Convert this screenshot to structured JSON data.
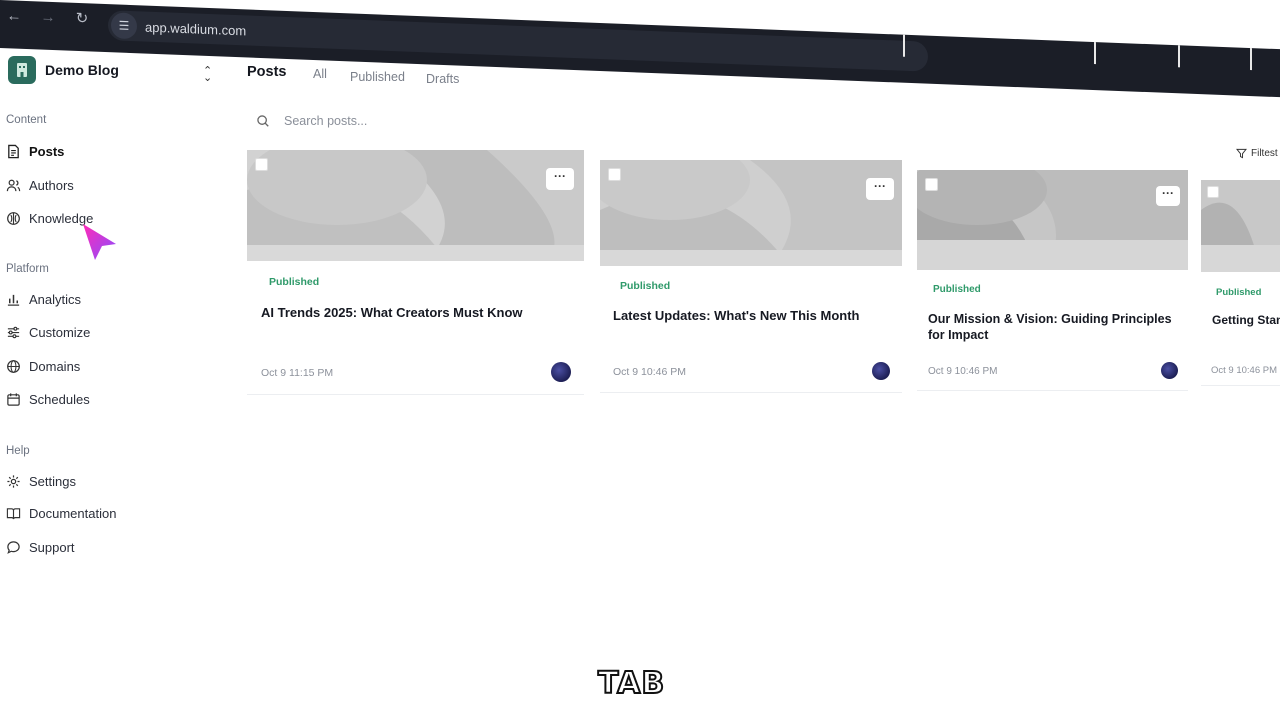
{
  "browser": {
    "url": "app.waldium.com",
    "back_icon": "arrow-left-icon",
    "forward_icon": "arrow-right-icon",
    "reload_icon": "reload-icon",
    "site_settings_icon": "tune-icon"
  },
  "brand": {
    "name": "Demo Blog",
    "logo_color": "#2a6b5d"
  },
  "sidebar": {
    "sections": [
      {
        "label": "Content",
        "items": [
          {
            "label": "Posts",
            "icon": "document-icon",
            "active": true
          },
          {
            "label": "Authors",
            "icon": "users-icon"
          },
          {
            "label": "Knowledge",
            "icon": "knowledge-icon"
          }
        ]
      },
      {
        "label": "Platform",
        "items": [
          {
            "label": "Analytics",
            "icon": "bar-chart-icon"
          },
          {
            "label": "Customize",
            "icon": "sliders-icon"
          },
          {
            "label": "Domains",
            "icon": "globe-icon"
          },
          {
            "label": "Schedules",
            "icon": "calendar-icon"
          }
        ]
      },
      {
        "label": "Help",
        "items": [
          {
            "label": "Settings",
            "icon": "gear-icon"
          },
          {
            "label": "Documentation",
            "icon": "book-icon"
          },
          {
            "label": "Support",
            "icon": "chat-icon"
          }
        ]
      }
    ]
  },
  "main": {
    "title": "Posts",
    "tabs": [
      "All",
      "Published",
      "Drafts"
    ],
    "search_placeholder": "Search posts...",
    "filter_label": "Filtest"
  },
  "posts": [
    {
      "status": "Published",
      "title": "AI Trends 2025: What Creators Must Know",
      "date": "Oct 9 11:15 PM"
    },
    {
      "status": "Published",
      "title": "Latest Updates: What's New This Month",
      "date": "Oct 9 10:46 PM"
    },
    {
      "status": "Published",
      "title": "Our Mission & Vision: Guiding Principles for Impact",
      "date": "Oct 9 10:46 PM"
    },
    {
      "status": "Published",
      "title": "Getting Stans",
      "date": "Oct 9 10:46 PM"
    }
  ],
  "more_label": "···",
  "caption": "TAB",
  "colors": {
    "published": "#2f9a6a",
    "cursor": "#e23bd6",
    "browser_bar": "#1b1e27"
  }
}
